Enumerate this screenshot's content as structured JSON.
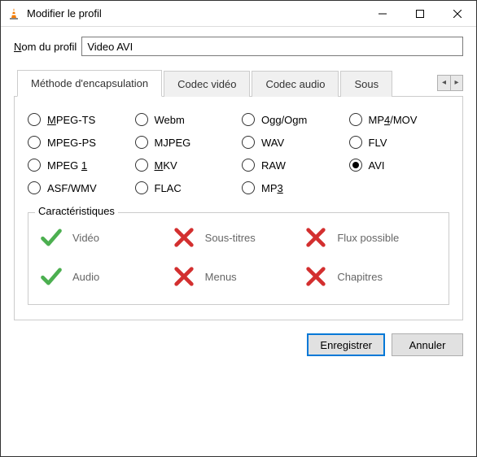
{
  "window": {
    "title": "Modifier le profil"
  },
  "profile_name": {
    "label_pre": "N",
    "label_post": "om du profil",
    "value": "Video AVI"
  },
  "tabs": {
    "encapsulation": "Méthode d'encapsulation",
    "video_codec": "Codec vidéo",
    "audio_codec": "Codec audio",
    "subtitles": "Sous"
  },
  "formats": {
    "mpeg_ts": "PEG-TS",
    "mpeg_ts_pre": "M",
    "mpeg_ps": "MPEG-PS",
    "mpeg_1_pre": "MPEG ",
    "mpeg_1_post": "1",
    "asf_wmv": "ASF/WMV",
    "webm": "Webm",
    "mjpeg": "MJPEG",
    "mkv_pre": "M",
    "mkv_post": "KV",
    "flac": "FLAC",
    "ogg": "Ogg/Ogm",
    "wav": "WAV",
    "raw": "RAW",
    "mp3_pre": "MP",
    "mp3_post": "3",
    "mp4_pre": "MP",
    "mp4_post": "4",
    "mp4_end": "/MOV",
    "flv": "FLV",
    "avi": "AVI"
  },
  "selected_format": "avi",
  "features": {
    "legend": "Caractéristiques",
    "video": "Vidéo",
    "audio": "Audio",
    "subtitles": "Sous-titres",
    "menus": "Menus",
    "streamable": "Flux possible",
    "chapters": "Chapitres"
  },
  "buttons": {
    "save": "Enregistrer",
    "cancel": "Annuler"
  }
}
